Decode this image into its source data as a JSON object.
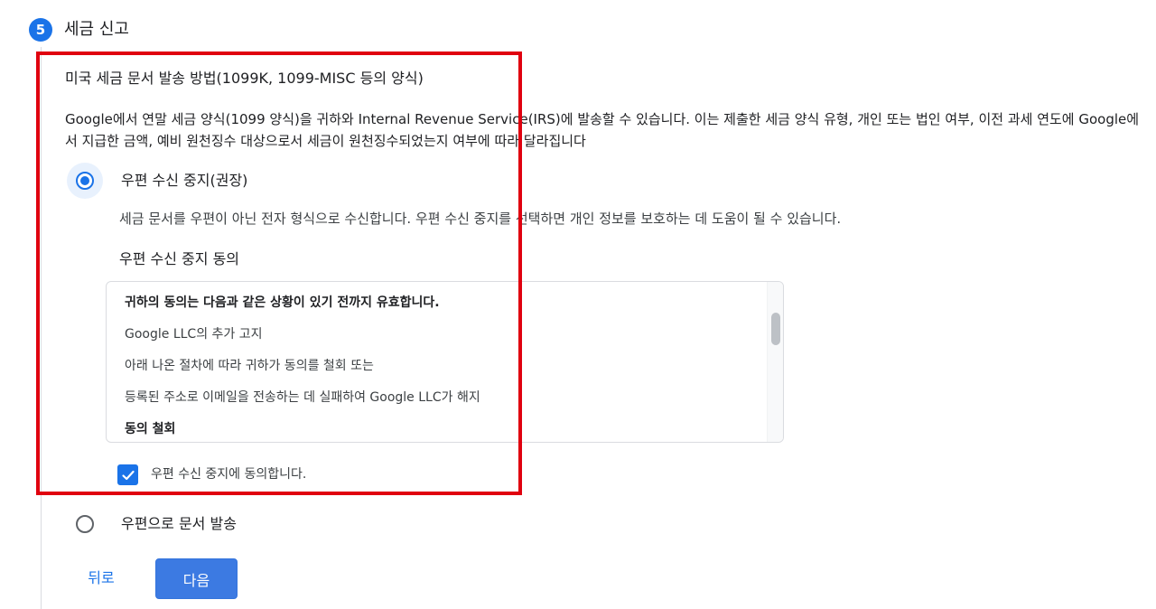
{
  "step": {
    "number": "5",
    "title": "세금 신고"
  },
  "section": {
    "heading": "미국 세금 문서 발송 방법(1099K, 1099-MISC 등의 양식)",
    "description": "Google에서 연말 세금 양식(1099 양식)을 귀하와 Internal Revenue Service(IRS)에 발송할 수 있습니다. 이는 제출한 세금 양식 유형, 개인 또는 법인 여부, 이전 과세 연도에 Google에서 지급한 금액, 예비 원천징수 대상으로서 세금이 원천징수되었는지 여부에 따라 달라집니다"
  },
  "options": [
    {
      "label": "우편 수신 중지(권장)",
      "selected": true,
      "description": "세금 문서를 우편이 아닌 전자 형식으로 수신합니다. 우편 수신 중지를 선택하면 개인 정보를 보호하는 데 도움이 될 수 있습니다."
    },
    {
      "label": "우편으로 문서 발송",
      "selected": false
    }
  ],
  "consent": {
    "title": "우편 수신 중지 동의",
    "lines": [
      {
        "text": "귀하의 동의는 다음과 같은 상황이 있기 전까지 유효합니다.",
        "bold": true
      },
      {
        "text": "Google LLC의 추가 고지",
        "bold": false
      },
      {
        "text": "아래 나온 절차에 따라 귀하가 동의를 철회 또는",
        "bold": false
      },
      {
        "text": "등록된 주소로 이메일을 전송하는 데 실패하여 Google LLC가 해지",
        "bold": false
      },
      {
        "text": "동의 철회",
        "bold": true
      }
    ],
    "checkbox_label": "우편 수신 중지에 동의합니다.",
    "checked": true
  },
  "buttons": {
    "back": "뒤로",
    "next": "다음"
  },
  "colors": {
    "accent": "#1a73e8",
    "highlight": "#e0000f"
  },
  "icons": {
    "checkbox": "checkmark-icon"
  }
}
